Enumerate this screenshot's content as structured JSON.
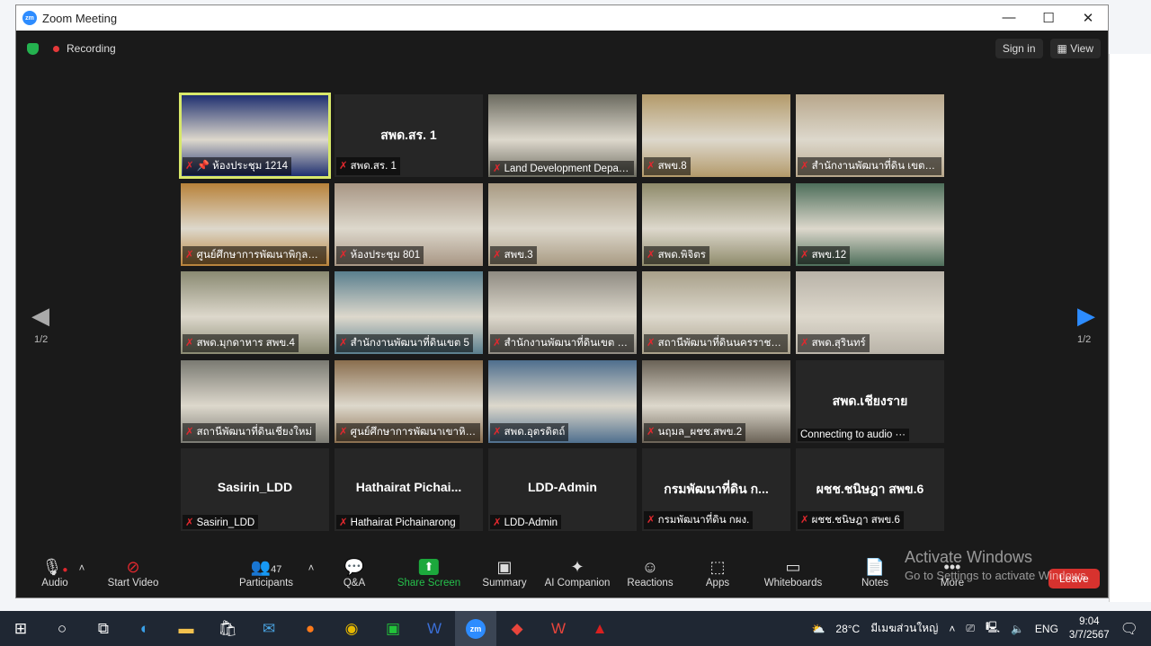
{
  "window": {
    "title": "Zoom Meeting",
    "minimize": "—",
    "maximize": "☐",
    "close": "✕"
  },
  "topbar": {
    "recording": "Recording",
    "sign_in": "Sign in",
    "view": "View"
  },
  "pager": {
    "left": "1/2",
    "right": "1/2"
  },
  "tiles": [
    {
      "name": "ห้องประชุม 1214",
      "bg": "#1b2c6e",
      "active": true,
      "pin": true
    },
    {
      "name": "สพด.สร. 1",
      "bg": "#262626",
      "big": "สพด.สร. 1"
    },
    {
      "name": "Land Development Depart...",
      "bg": "#6b6a5f"
    },
    {
      "name": "สพข.8",
      "bg": "#b39a6a"
    },
    {
      "name": "สำนักงานพัฒนาที่ดิน เขตหก",
      "bg": "#b8a78b"
    },
    {
      "name": "ศูนย์ศึกษาการพัฒนาพิกุลทอ...",
      "bg": "#b8823a"
    },
    {
      "name": "ห้องประชุม 801",
      "bg": "#a89684"
    },
    {
      "name": "สพข.3",
      "bg": "#a89a82"
    },
    {
      "name": "สพด.พิจิตร",
      "bg": "#8e8a6a"
    },
    {
      "name": "สพข.12",
      "bg": "#4d6e5a"
    },
    {
      "name": "สพด.มุกดาหาร สพข.4",
      "bg": "#8a8a72"
    },
    {
      "name": "สำนักงานพัฒนาที่ดินเขต 5",
      "bg": "#5a7f8e"
    },
    {
      "name": "สำนักงานพัฒนาที่ดินเขต 4 ...",
      "bg": "#8f8b82"
    },
    {
      "name": "สถานีพัฒนาที่ดินนครราชสีมา",
      "bg": "#a8a08a"
    },
    {
      "name": "สพด.สุรินทร์",
      "bg": "#b9b3a8"
    },
    {
      "name": "สถานีพัฒนาที่ดินเชียงใหม่",
      "bg": "#7a7a72"
    },
    {
      "name": "ศูนย์ศึกษาการพัฒนาเขาหิน...",
      "bg": "#8a6e4e"
    },
    {
      "name": "สพด.อุตรดิตถ์",
      "bg": "#4f6f8e"
    },
    {
      "name": "นฤมล_ผชช.สพข.2",
      "bg": "#6a6256"
    },
    {
      "name": "Connecting to audio ···",
      "bg": "#262626",
      "big": "สพด.เชียงราย",
      "nomute": true
    },
    {
      "name": "Sasirin_LDD",
      "bg": "#262626",
      "big": "Sasirin_LDD"
    },
    {
      "name": "Hathairat Pichainarong",
      "bg": "#262626",
      "big": "Hathairat  Pichai..."
    },
    {
      "name": "LDD-Admin",
      "bg": "#262626",
      "big": "LDD-Admin"
    },
    {
      "name": "กรมพัฒนาที่ดิน กผง.",
      "bg": "#262626",
      "big": "กรมพัฒนาที่ดิน ก..."
    },
    {
      "name": "ผชช.ชนิษฎา สพข.6",
      "bg": "#262626",
      "big": "ผชช.ชนิษฎา สพข.6"
    }
  ],
  "toolbar": {
    "audio": "Audio",
    "video": "Start Video",
    "participants": "Participants",
    "participants_count": "47",
    "qa": "Q&A",
    "share": "Share Screen",
    "summary": "Summary",
    "ai": "AI Companion",
    "reactions": "Reactions",
    "apps": "Apps",
    "whiteboards": "Whiteboards",
    "notes": "Notes",
    "more": "More",
    "leave": "Leave"
  },
  "watermark": {
    "line1": "Activate Windows",
    "line2": "Go to Settings to activate Windows."
  },
  "taskbar": {
    "weather": "28°C",
    "weather_text": "มีเมฆส่วนใหญ่",
    "lang": "ENG",
    "time": "9:04",
    "date": "3/7/2567"
  },
  "colors": {
    "accent": "#2d8cff",
    "mute": "#e0282e",
    "share": "#25c04b",
    "leave": "#d7322e"
  }
}
